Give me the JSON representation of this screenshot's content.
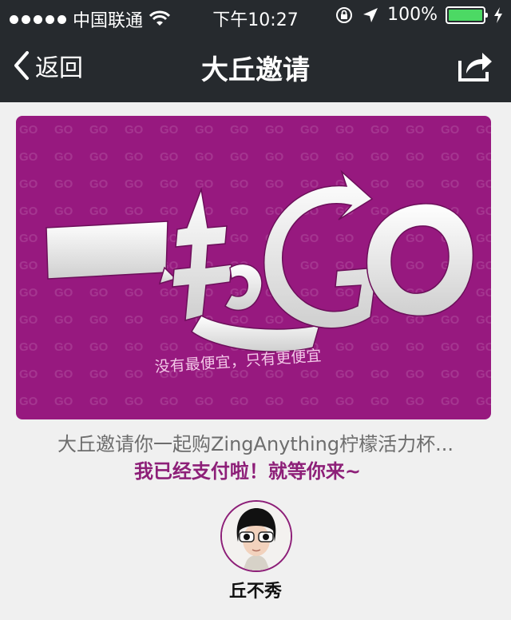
{
  "status_bar": {
    "carrier": "中国联通",
    "time": "下午10:27",
    "battery": "100%",
    "battery_level": 1.0,
    "icons": [
      "signal-dots",
      "wifi-icon",
      "rotation-lock-icon",
      "location-arrow-icon",
      "battery-icon",
      "charging-bolt-icon"
    ]
  },
  "nav": {
    "back_label": "返回",
    "title": "大丘邀请",
    "icons": [
      "chevron-left-icon",
      "share-icon"
    ]
  },
  "banner": {
    "headline": "一起GO",
    "pattern_text": "GO",
    "slogan": "没有最便宜，只有更便宜",
    "colors": {
      "background": "#97197f",
      "headline": "#ffffff"
    }
  },
  "content": {
    "item_title": "大丘邀请你一起购ZingAnything柠檬活力杯...",
    "status": "我已经支付啦！就等你来~"
  },
  "user": {
    "name": "丘不秀"
  },
  "colors": {
    "accent": "#8d1f78",
    "nav_bg": "#262a2e",
    "page_bg": "#f0f0f0"
  }
}
